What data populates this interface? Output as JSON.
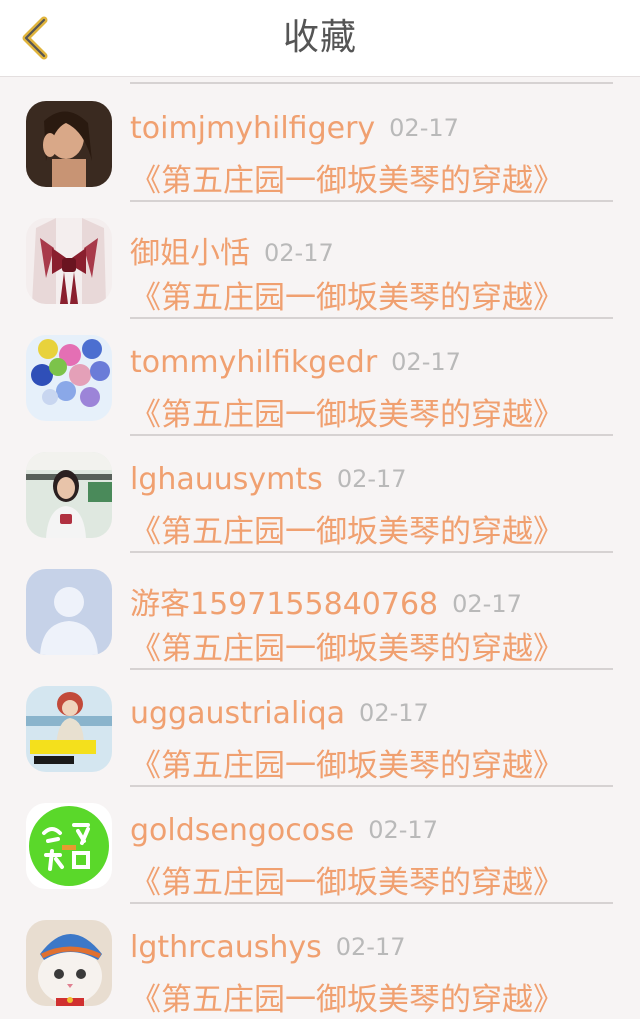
{
  "header": {
    "title": "收藏",
    "back_icon": "chevron-left-icon",
    "accent_color": "#e0b43c"
  },
  "colors": {
    "username": "#f0a070",
    "date": "#b9b9b9",
    "work_title": "#f0a070"
  },
  "items": [
    {
      "username": "toimjmyhilfigery",
      "date": "02-17",
      "work": "《第五庄园一御坂美琴的穿越》",
      "avatar": "woman-portrait-avatar"
    },
    {
      "username": "御姐小恬",
      "date": "02-17",
      "work": "《第五庄园一御坂美琴的穿越》",
      "avatar": "kimono-bow-avatar"
    },
    {
      "username": "tommyhilfikgedr",
      "date": "02-17",
      "work": "《第五庄园一御坂美琴的穿越》",
      "avatar": "balloons-avatar"
    },
    {
      "username": "lghauusymts",
      "date": "02-17",
      "work": "《第五庄园一御坂美琴的穿越》",
      "avatar": "girl-cafe-avatar"
    },
    {
      "username": "游客1597155840768",
      "date": "02-17",
      "work": "《第五庄园一御坂美琴的穿越》",
      "avatar": "default-user-avatar"
    },
    {
      "username": "uggaustrialiqa",
      "date": "02-17",
      "work": "《第五庄园一御坂美琴的穿越》",
      "avatar": "cartoon-girl-avatar"
    },
    {
      "username": "goldsengocose",
      "date": "02-17",
      "work": "《第五庄园一御坂美琴的穿越》",
      "avatar": "green-exam-avatar"
    },
    {
      "username": "lgthrcaushys",
      "date": "02-17",
      "work": "《第五庄园一御坂美琴的穿越》",
      "avatar": "cat-hat-avatar"
    }
  ]
}
